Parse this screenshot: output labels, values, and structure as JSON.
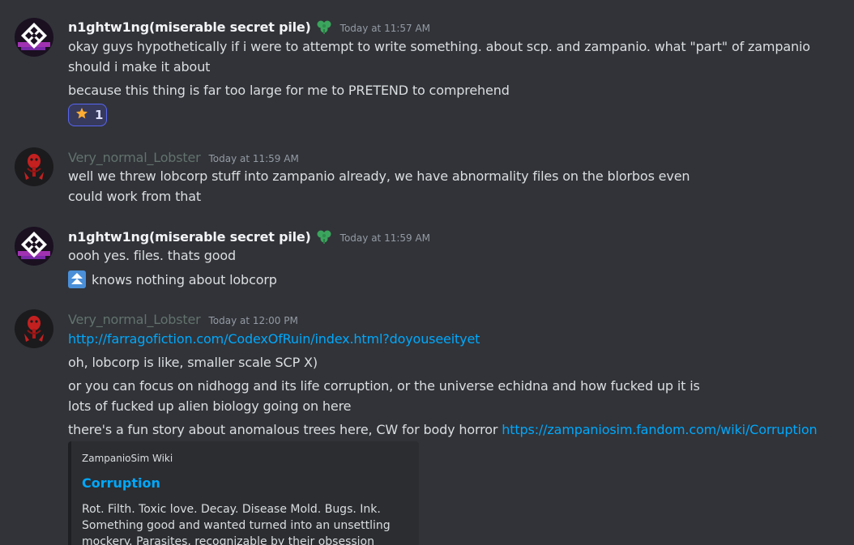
{
  "messages": [
    {
      "author": "n1ghtw1ng(miserable secret pile)",
      "role_icon": "green-leaf-icon",
      "timestamp": "Today at 11:57 AM",
      "lines": [
        "okay guys hypothetically if i were to attempt to write something. about scp. and zampanio. what \"part\" of zampanio should i make it about",
        "because this thing is far too large for me to PRETEND to comprehend"
      ],
      "reaction": {
        "emoji": "star-icon",
        "count": "1"
      }
    },
    {
      "author": "Very_normal_Lobster",
      "timestamp": "Today at 11:59 AM",
      "lines": [
        "well we threw lobcorp stuff into zampanio already, we have abnormality files on the blorbos even",
        "could work from that"
      ]
    },
    {
      "author": "n1ghtw1ng(miserable secret pile)",
      "role_icon": "green-leaf-icon",
      "timestamp": "Today at 11:59 AM",
      "lines": [
        "oooh yes. files. thats good",
        "knows nothing about lobcorp"
      ],
      "inline_emoji": "double-arrow-up-icon"
    },
    {
      "author": "Very_normal_Lobster",
      "timestamp": "Today at 12:00 PM",
      "lines": [
        "http://farragofiction.com/CodexOfRuin/index.html?doyouseeityet",
        "oh, lobcorp is like, smaller scale SCP X)",
        "or you can focus on nidhogg and its life corruption, or the universe echidna and how fucked up it is",
        "lots of fucked up alien biology going on here",
        "there's a fun story about anomalous trees here, CW for body horror "
      ],
      "link": "https://zampaniosim.fandom.com/wiki/Corruption",
      "embed": {
        "provider": "ZampanioSim Wiki",
        "title": "Corruption",
        "description": "Rot. Filth. Toxic love. Decay. Disease Mold. Bugs. Ink. Something good and wanted turned into an unsettling mockery. Parasites, recognizable by their obsession fueled"
      }
    }
  ],
  "colors": {
    "background": "#313338",
    "link": "#00a8fc",
    "lobster_name": "#62726c",
    "reaction_border": "#5865f2"
  }
}
